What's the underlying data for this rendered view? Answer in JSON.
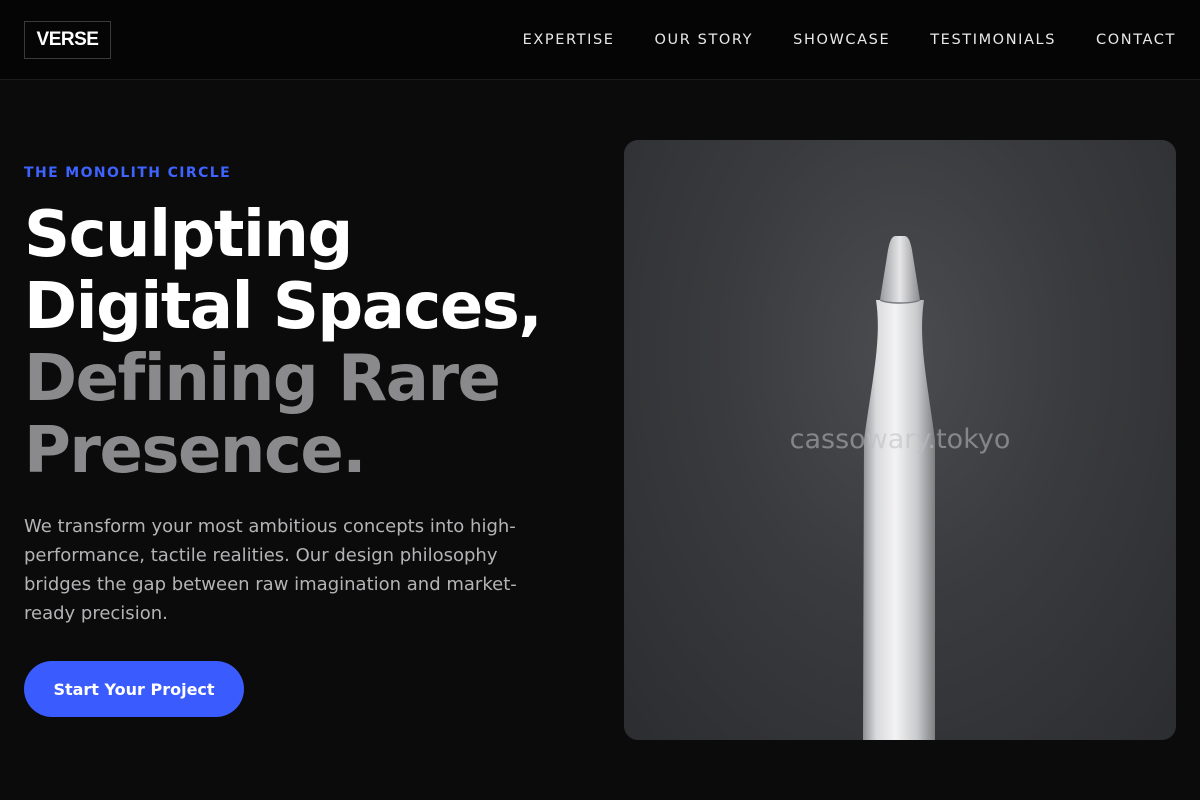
{
  "header": {
    "logo": "VERSE",
    "nav": [
      "EXPERTISE",
      "OUR STORY",
      "SHOWCASE",
      "TESTIMONIALS",
      "CONTACT"
    ]
  },
  "hero": {
    "eyebrow": "THE MONOLITH CIRCLE",
    "headline_lines": [
      "Sculpting",
      "Digital Spaces,",
      "Defining Rare",
      "Presence."
    ],
    "description": "We transform your most ambitious concepts into high-performance, tactile realities. Our design philosophy bridges the gap between raw imagination and market-ready precision.",
    "cta_label": "Start Your Project",
    "image_watermark": "cassowary.tokyo"
  },
  "colors": {
    "accent": "#3a5cff",
    "background": "#0b0b0c",
    "headline_muted": "#8a8a8c"
  },
  "icons": {
    "hero_image": "stylus-pencil-photo"
  }
}
